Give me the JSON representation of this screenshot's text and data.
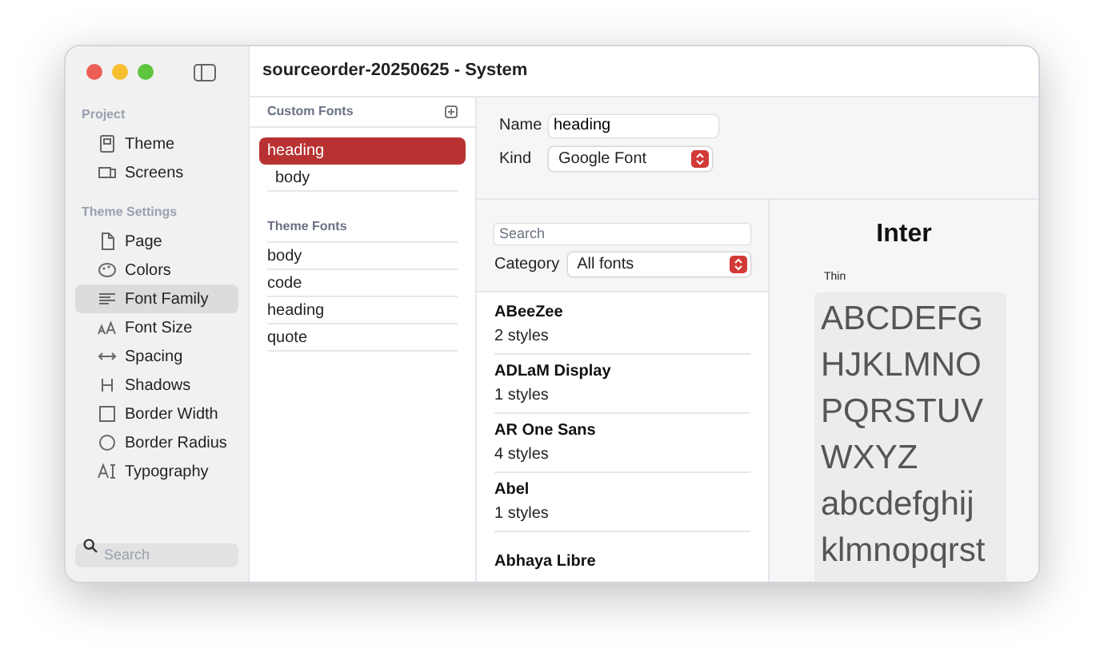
{
  "window": {
    "title": "sourceorder-20250625 - System"
  },
  "sidebar": {
    "sections": [
      {
        "heading": "Project",
        "items": [
          {
            "label": "Theme",
            "selected": false
          },
          {
            "label": "Screens",
            "selected": false
          }
        ]
      },
      {
        "heading": "Theme Settings",
        "items": [
          {
            "label": "Page",
            "selected": false
          },
          {
            "label": "Colors",
            "selected": false
          },
          {
            "label": "Font Family",
            "selected": true
          },
          {
            "label": "Font Size",
            "selected": false
          },
          {
            "label": "Spacing",
            "selected": false
          },
          {
            "label": "Shadows",
            "selected": false
          },
          {
            "label": "Border Width",
            "selected": false
          },
          {
            "label": "Border Radius",
            "selected": false
          },
          {
            "label": "Typography",
            "selected": false
          }
        ]
      }
    ],
    "search": {
      "placeholder": "Search"
    }
  },
  "custom_fonts": {
    "title": "Custom Fonts",
    "items": [
      {
        "label": "heading",
        "selected": true
      },
      {
        "label": "body",
        "selected": false
      }
    ]
  },
  "theme_fonts": {
    "title": "Theme Fonts",
    "items": [
      {
        "label": "body",
        "selected": false
      },
      {
        "label": "code",
        "selected": false
      },
      {
        "label": "heading",
        "selected": false
      },
      {
        "label": "quote",
        "selected": false
      }
    ]
  },
  "editor": {
    "name_label": "Name",
    "name_value": "heading",
    "kind_label": "Kind",
    "kind_value": "Google Font"
  },
  "font_browser": {
    "search": {
      "placeholder": "Search"
    },
    "category_label": "Category",
    "category_value": "All fonts",
    "fonts": [
      {
        "name": "ABeeZee",
        "styles": "2 styles"
      },
      {
        "name": "ADLaM Display",
        "styles": "1 styles"
      },
      {
        "name": "AR One Sans",
        "styles": "4 styles"
      },
      {
        "name": "Abel",
        "styles": "1 styles"
      },
      {
        "name": "Abhaya Libre"
      }
    ]
  },
  "preview": {
    "title": "Inter",
    "weight_label": "Thin",
    "sample_lines": [
      "ABCDEFG",
      "HJKLMNO",
      "PQRSTUV",
      "WXYZ",
      "abcdefghij",
      "klmnopqrst"
    ]
  }
}
